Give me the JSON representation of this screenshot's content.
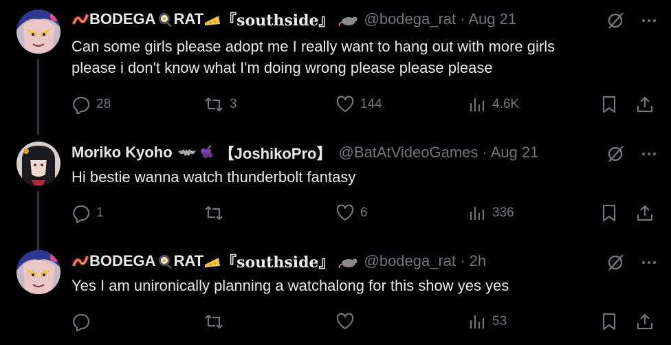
{
  "tweets": [
    {
      "name_prefix": "BODEGA",
      "name_mid": "RAT",
      "name_suffix": "『southside』",
      "handle": "@bodega_rat",
      "time": "· Aug 21",
      "text_lines": [
        "Can some girls please adopt me I really want to hang out with more girls",
        "please i don't know what I'm doing wrong please please please"
      ],
      "replies": "28",
      "reposts": "3",
      "likes": "144",
      "views": "4.6K"
    },
    {
      "name_prefix": "Moriko Kyoho",
      "name_suffix": "【JoshikoPro】",
      "handle": "@BatAtVideoGames",
      "time": "· Aug 21",
      "text_lines": [
        "Hi bestie wanna watch thunderbolt fantasy"
      ],
      "replies": "1",
      "reposts": "",
      "likes": "6",
      "views": "336"
    },
    {
      "name_prefix": "BODEGA",
      "name_mid": "RAT",
      "name_suffix": "『southside』",
      "handle": "@bodega_rat",
      "time": "· 2h",
      "text_lines": [
        "Yes I am unironically planning a watchalong for this show yes yes"
      ],
      "replies": "",
      "reposts": "",
      "likes": "",
      "views": "53"
    }
  ],
  "icons": {
    "reply": "reply-icon",
    "repost": "repost-icon",
    "like": "heart-icon",
    "views": "views-icon",
    "bookmark": "bookmark-icon",
    "share": "share-icon",
    "grok": "grok-icon",
    "more": "more-icon"
  },
  "colors": {
    "background": "#000000",
    "text": "#e7e9ea",
    "muted": "#71767b",
    "thread_line": "#333639"
  }
}
